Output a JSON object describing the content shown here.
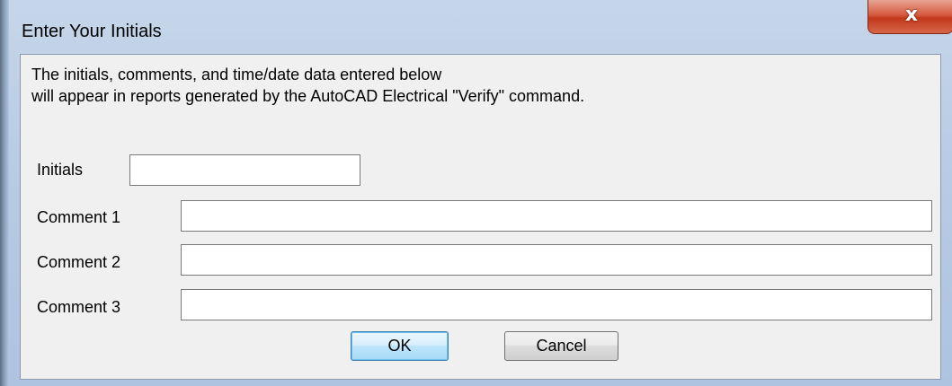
{
  "window": {
    "title": "Enter Your Initials",
    "close_glyph": "x"
  },
  "info": {
    "line1": "The initials, comments, and time/date data entered below",
    "line2": "will appear in reports generated by the AutoCAD Electrical \"Verify\" command."
  },
  "fields": {
    "initials": {
      "label": "Initials",
      "value": ""
    },
    "comment1": {
      "label": "Comment 1",
      "value": ""
    },
    "comment2": {
      "label": "Comment 2",
      "value": ""
    },
    "comment3": {
      "label": "Comment 3",
      "value": ""
    }
  },
  "buttons": {
    "ok_label": "OK",
    "cancel_label": "Cancel"
  },
  "colors": {
    "frame": "#b9cce5",
    "client": "#f0f0f0",
    "close_button": "#c2381c"
  },
  "icons": {
    "close": "close-icon"
  }
}
